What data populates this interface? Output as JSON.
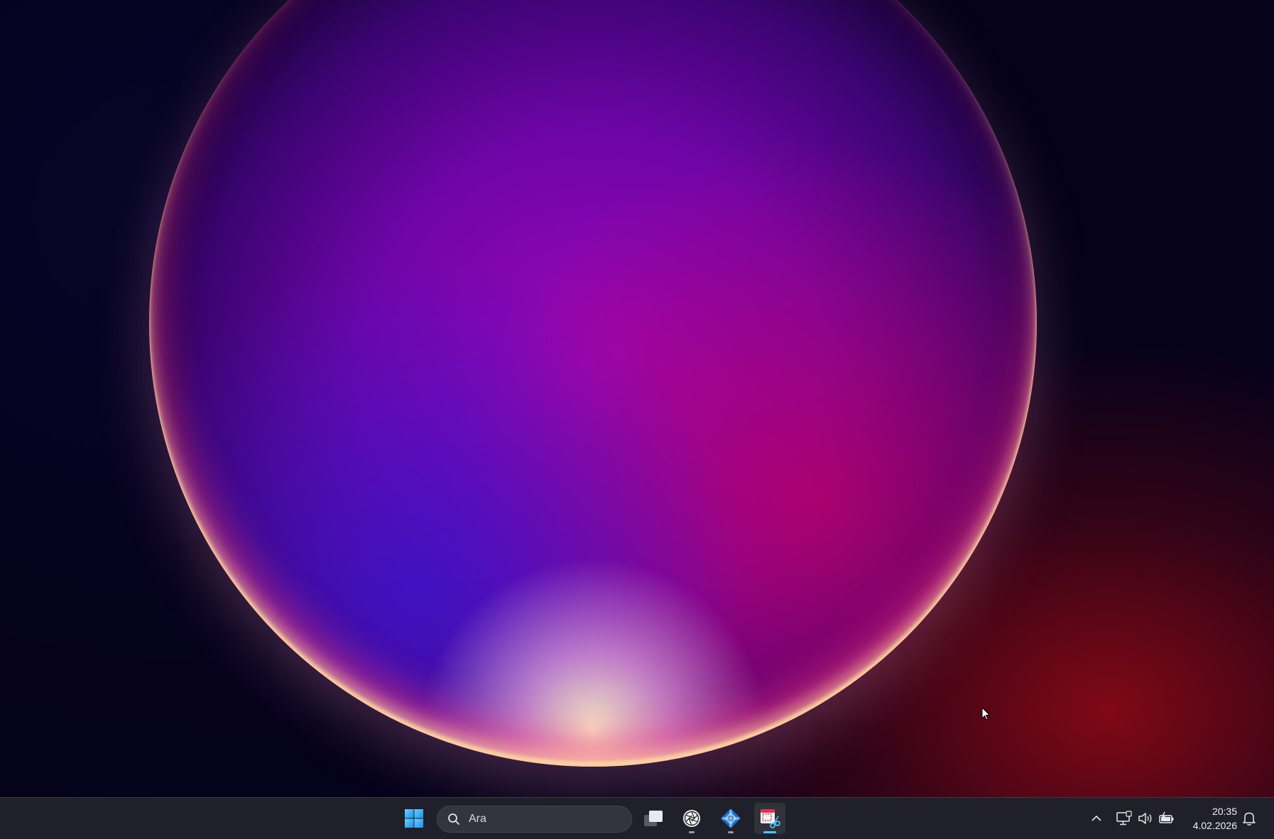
{
  "taskbar": {
    "search": {
      "placeholder": "Ara"
    },
    "pinned_apps": [
      {
        "name": "start",
        "icon": "windows-logo-icon",
        "running": false
      },
      {
        "name": "task-view",
        "icon": "task-view-icon",
        "running": false
      },
      {
        "name": "app-1",
        "icon": "aperture-app-icon",
        "running": true
      },
      {
        "name": "app-2",
        "icon": "blue-diamond-app-icon",
        "running": true
      },
      {
        "name": "snipping-tool",
        "icon": "snipping-tool-icon",
        "running": true,
        "active": true
      }
    ],
    "tray": {
      "icons": [
        "chevron-up-icon",
        "network-icon",
        "volume-icon",
        "battery-icon"
      ],
      "time": "20:35",
      "date": "4.02.2026",
      "notification_icon": "bell-icon"
    }
  },
  "colors": {
    "taskbar_bg": "#20202a",
    "accent": "#4cc2ff",
    "windows_blue": "#2aa4f4"
  }
}
